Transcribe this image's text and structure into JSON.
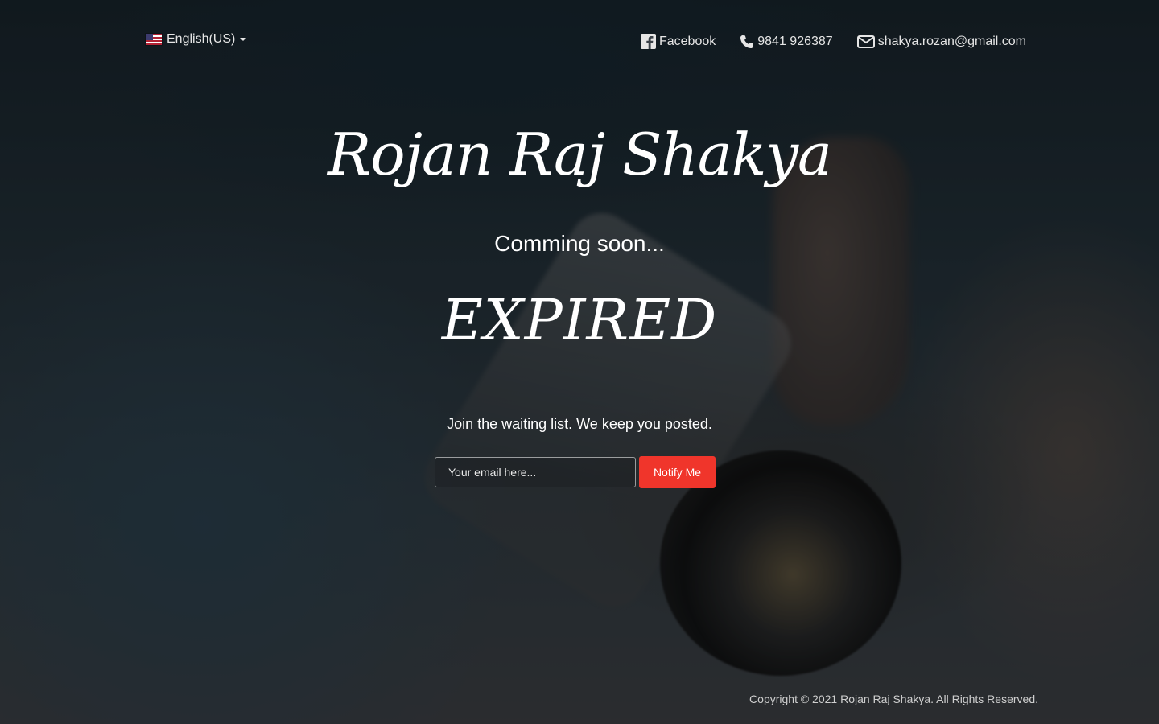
{
  "header": {
    "language": {
      "label": "English(US)",
      "flag_icon": "us-flag-icon"
    },
    "contacts": [
      {
        "icon": "facebook-icon",
        "label": "Facebook"
      },
      {
        "icon": "phone-icon",
        "label": "9841 926387"
      },
      {
        "icon": "envelope-icon",
        "label": "shakya.rozan@gmail.com"
      }
    ]
  },
  "hero": {
    "brand_name": "Rojan Raj Shakya",
    "tagline": "Comming soon...",
    "countdown_status": "EXPIRED",
    "waiting_text": "Join the waiting list. We keep you posted."
  },
  "signup": {
    "email_placeholder": "Your email here...",
    "email_value": "",
    "notify_label": "Notify Me",
    "button_color": "#f0352b"
  },
  "footer": {
    "copyright": "Copyright © 2021 Rojan Raj Shakya. All Rights Reserved."
  }
}
